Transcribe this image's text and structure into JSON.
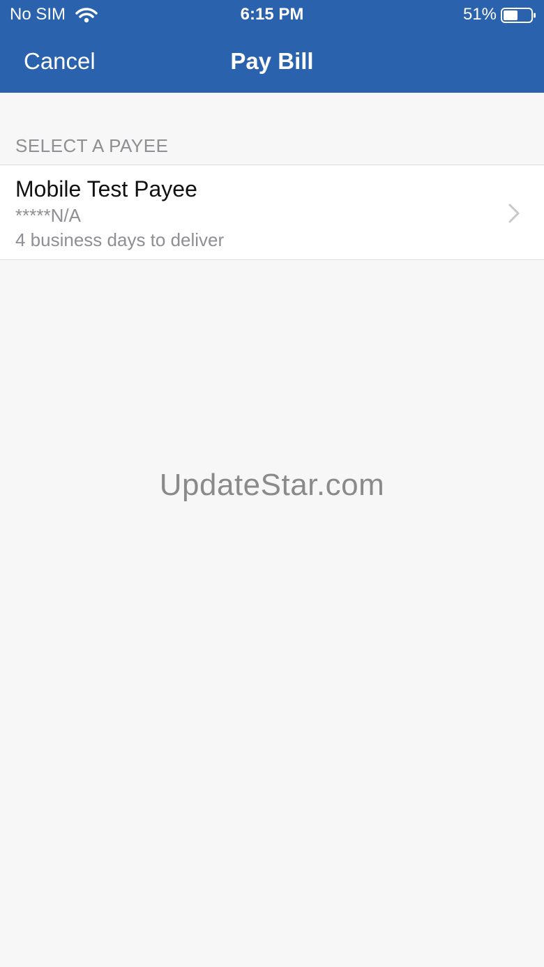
{
  "status_bar": {
    "carrier": "No SIM",
    "time": "6:15 PM",
    "battery_percent": "51%",
    "wifi_icon": "wifi-icon",
    "battery_icon": "battery-icon"
  },
  "nav": {
    "cancel_label": "Cancel",
    "title": "Pay Bill"
  },
  "payees": {
    "section_title": "SELECT A PAYEE",
    "items": [
      {
        "name": "Mobile Test Payee",
        "account": "*****N/A",
        "delivery": "4 business days to deliver",
        "chevron_icon": "chevron-right-icon"
      }
    ]
  },
  "watermark": "UpdateStar.com",
  "colors": {
    "header_bg": "#2a62ad",
    "page_bg": "#f7f7f7",
    "secondary_text": "#8e8e93"
  }
}
